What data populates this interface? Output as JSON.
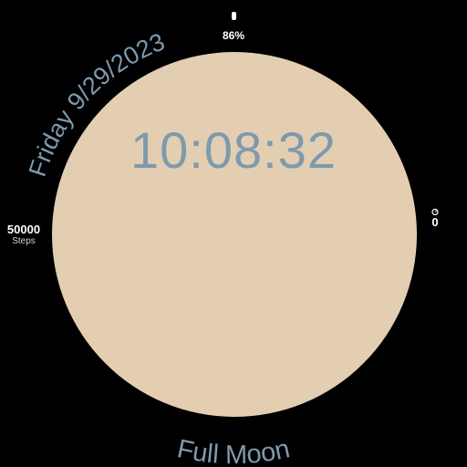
{
  "watch_face": {
    "date": "Friday 9/29/2023",
    "time": "10:08:32",
    "moon_phase": "Full Moon",
    "battery": {
      "label": "86%",
      "icon": "battery-icon"
    },
    "steps": {
      "value": "50000",
      "label": "Steps"
    },
    "right_complication": {
      "value": "0",
      "icon": "timer-icon"
    },
    "colors": {
      "background": "#000000",
      "moon": "#E4CEB1",
      "accent_text": "#7D9AAE",
      "white_text": "#FFFFFF"
    }
  }
}
